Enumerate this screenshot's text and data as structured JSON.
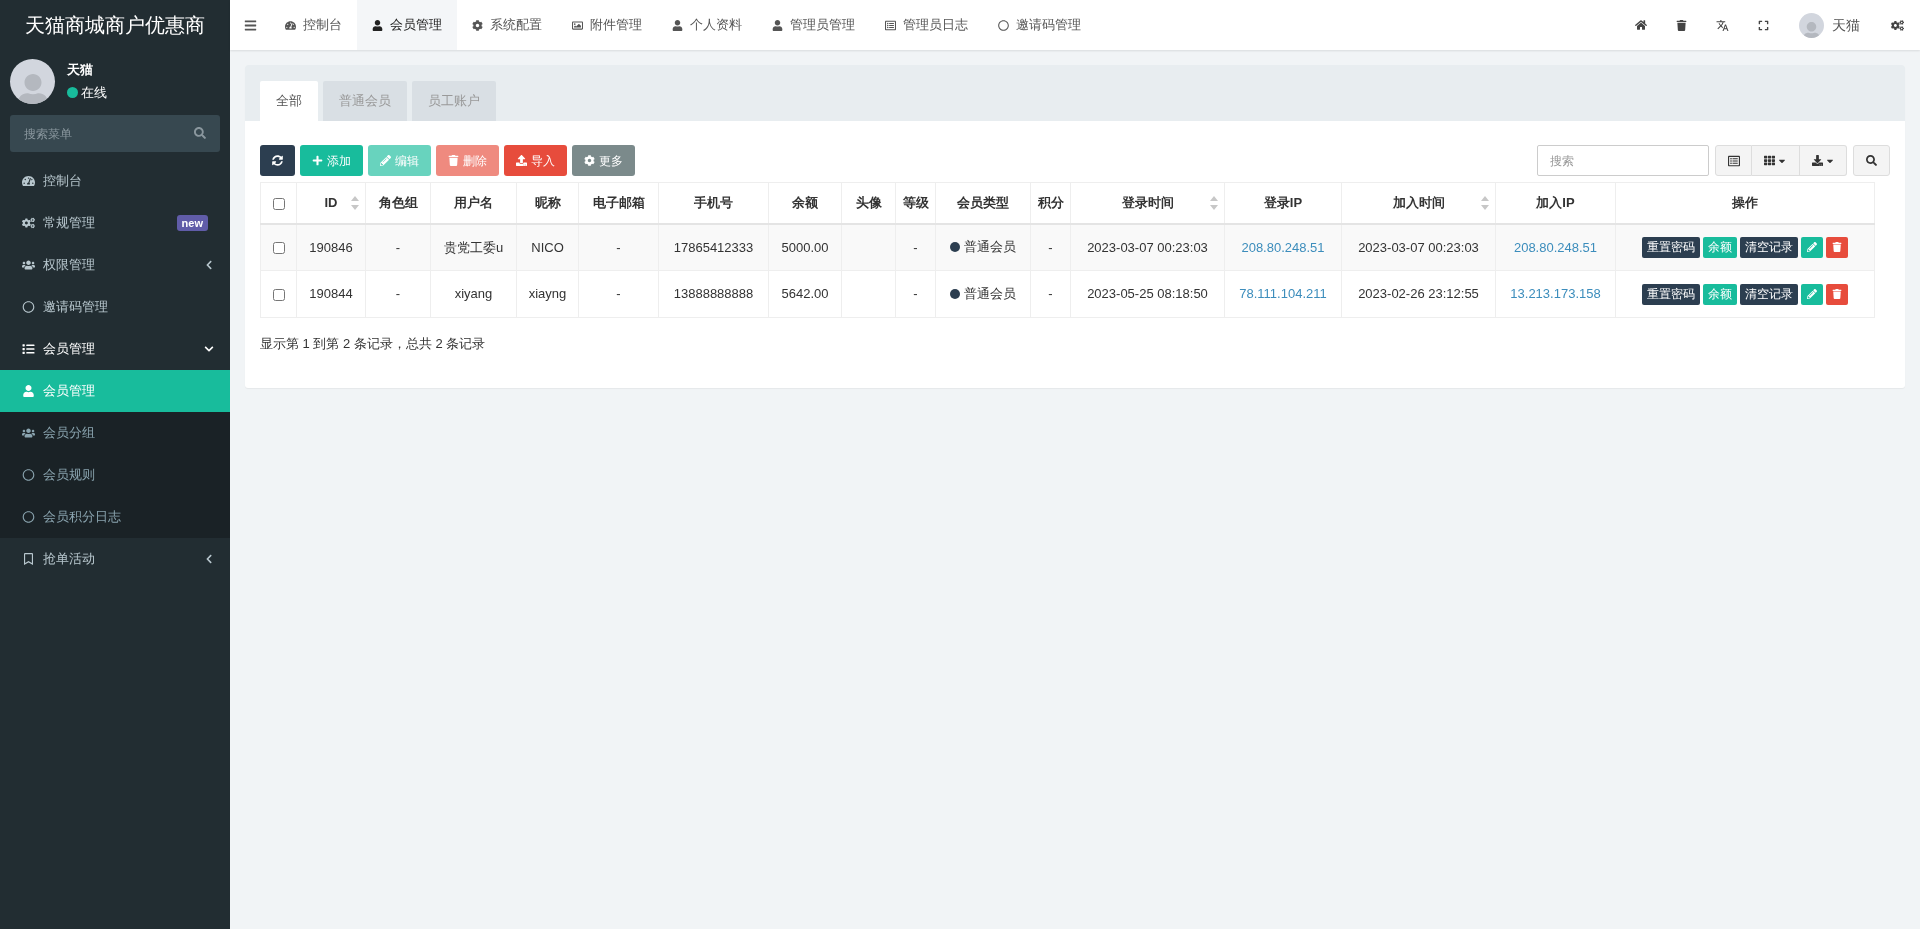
{
  "brand": "天猫商城商户优惠商",
  "user": {
    "name": "天猫",
    "status": "在线"
  },
  "sidebar_search": {
    "placeholder": "搜索菜单"
  },
  "sidebar": [
    {
      "label": "控制台",
      "expanded": false,
      "has_children": false,
      "selected": false
    },
    {
      "label": "常规管理",
      "badge": "new",
      "expanded": false,
      "has_children": false,
      "selected": false
    },
    {
      "label": "权限管理",
      "expanded": false,
      "has_children": true,
      "selected": false
    },
    {
      "label": "邀请码管理",
      "expanded": false,
      "has_children": false,
      "selected": false
    },
    {
      "label": "会员管理",
      "expanded": true,
      "has_children": true,
      "selected": false,
      "children": [
        {
          "label": "会员管理",
          "selected": true
        },
        {
          "label": "会员分组",
          "selected": false
        },
        {
          "label": "会员规则",
          "selected": false
        },
        {
          "label": "会员积分日志",
          "selected": false
        }
      ]
    },
    {
      "label": "抢单活动",
      "expanded": false,
      "has_children": true,
      "selected": false
    }
  ],
  "nav_tabs": [
    {
      "label": "控制台",
      "selected": false
    },
    {
      "label": "会员管理",
      "selected": true
    },
    {
      "label": "系统配置",
      "selected": false
    },
    {
      "label": "附件管理",
      "selected": false
    },
    {
      "label": "个人资料",
      "selected": false
    },
    {
      "label": "管理员管理",
      "selected": false
    },
    {
      "label": "管理员日志",
      "selected": false
    },
    {
      "label": "邀请码管理",
      "selected": false
    }
  ],
  "top_user": "天猫",
  "filter_tabs": [
    {
      "label": "全部",
      "selected": true
    },
    {
      "label": "普通会员",
      "selected": false
    },
    {
      "label": "员工账户",
      "selected": false
    }
  ],
  "toolbar": [
    {
      "kind": "refresh",
      "disabled": false
    },
    {
      "kind": "add",
      "label": "添加",
      "disabled": false
    },
    {
      "kind": "edit",
      "label": "编辑",
      "disabled": true
    },
    {
      "kind": "delete",
      "label": "删除",
      "disabled": true
    },
    {
      "kind": "import",
      "label": "导入",
      "disabled": false
    },
    {
      "kind": "more",
      "label": "更多",
      "disabled": false
    }
  ],
  "table_search": {
    "placeholder": "搜索"
  },
  "table": {
    "header_checked": false,
    "columns": [
      {
        "label": "ID",
        "sortable": true
      },
      {
        "label": "角色组",
        "sortable": false
      },
      {
        "label": "用户名",
        "sortable": false
      },
      {
        "label": "昵称",
        "sortable": false
      },
      {
        "label": "电子邮箱",
        "sortable": false
      },
      {
        "label": "手机号",
        "sortable": false
      },
      {
        "label": "余额",
        "sortable": false
      },
      {
        "label": "头像",
        "sortable": false
      },
      {
        "label": "等级",
        "sortable": false
      },
      {
        "label": "会员类型",
        "sortable": false
      },
      {
        "label": "积分",
        "sortable": false
      },
      {
        "label": "登录时间",
        "sortable": true
      },
      {
        "label": "登录IP",
        "sortable": false
      },
      {
        "label": "加入时间",
        "sortable": true
      },
      {
        "label": "加入IP",
        "sortable": false
      },
      {
        "label": "操作",
        "sortable": false
      }
    ],
    "rows": [
      {
        "checked": false,
        "id": "190846",
        "group": "-",
        "username": "贵党工委u",
        "nickname": "NICO",
        "email": "-",
        "mobile": "17865412333",
        "balance": "5000.00",
        "level": "-",
        "type": "普通会员",
        "score": "-",
        "login_time": "2023-03-07 00:23:03",
        "login_ip": "208.80.248.51",
        "join_time": "2023-03-07 00:23:03",
        "join_ip": "208.80.248.51",
        "actions": [
          {
            "kind": "dark",
            "label": "重置密码"
          },
          {
            "kind": "green",
            "label": "余额"
          },
          {
            "kind": "dark",
            "label": "清空记录"
          }
        ]
      },
      {
        "checked": false,
        "id": "190844",
        "group": "-",
        "username": "xiyang",
        "nickname": "xiayng",
        "email": "-",
        "mobile": "13888888888",
        "balance": "5642.00",
        "level": "-",
        "type": "普通会员",
        "score": "-",
        "login_time": "2023-05-25 08:18:50",
        "login_ip": "78.111.104.211",
        "join_time": "2023-02-26 23:12:55",
        "join_ip": "13.213.173.158",
        "actions": [
          {
            "kind": "dark",
            "label": "重置密码"
          },
          {
            "kind": "green",
            "label": "余额"
          },
          {
            "kind": "dark",
            "label": "清空记录"
          }
        ]
      }
    ]
  },
  "pagination_info": "显示第 1 到第 2 条记录，总共 2 条记录"
}
